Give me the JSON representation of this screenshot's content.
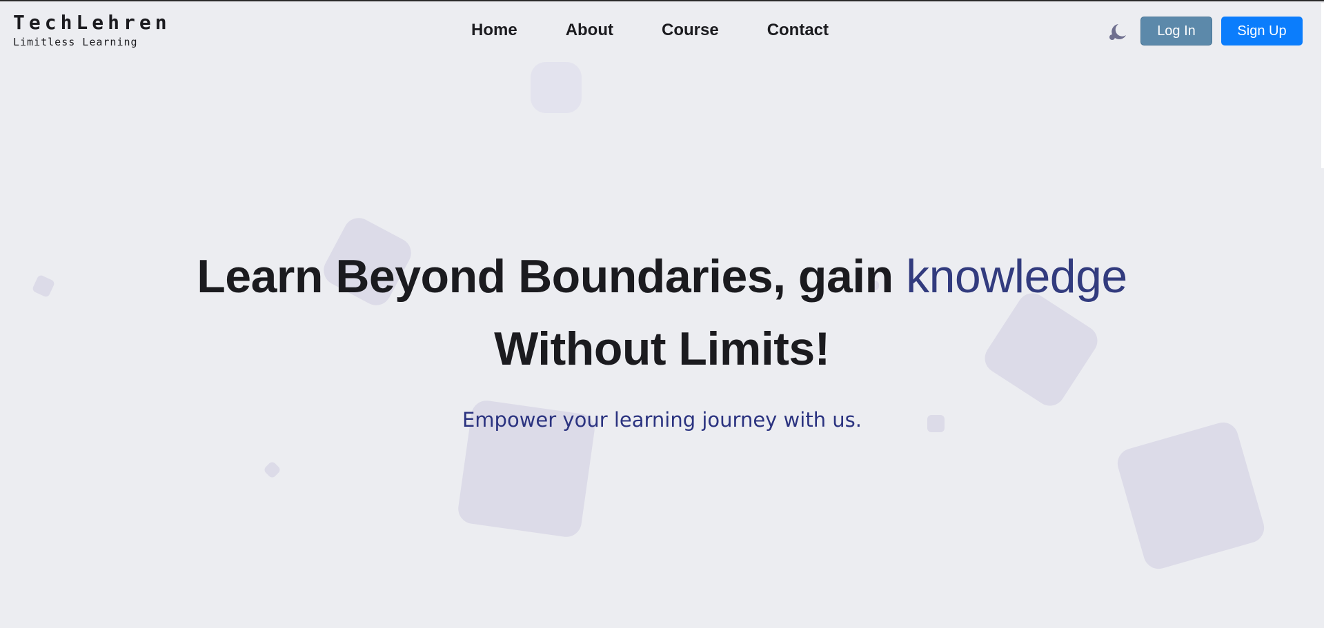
{
  "brand": {
    "name": "TechLehren",
    "tagline": "Limitless Learning"
  },
  "nav": {
    "items": [
      {
        "label": "Home"
      },
      {
        "label": "About"
      },
      {
        "label": "Course"
      },
      {
        "label": "Contact"
      }
    ]
  },
  "header": {
    "theme_toggle_icon": "moon-icon",
    "login_label": "Log In",
    "signup_label": "Sign Up"
  },
  "hero": {
    "headline_part1": "Learn Beyond Boundaries, gain",
    "headline_accent": "knowledge",
    "headline_line2": "Without Limits!",
    "subtitle": "Empower your learning journey with us."
  },
  "colors": {
    "background": "#ecedf1",
    "accent_text": "#323b7e",
    "login_button": "#5c89aa",
    "signup_button": "#0b7dfc",
    "decor_shape": "#dcdbe8"
  }
}
